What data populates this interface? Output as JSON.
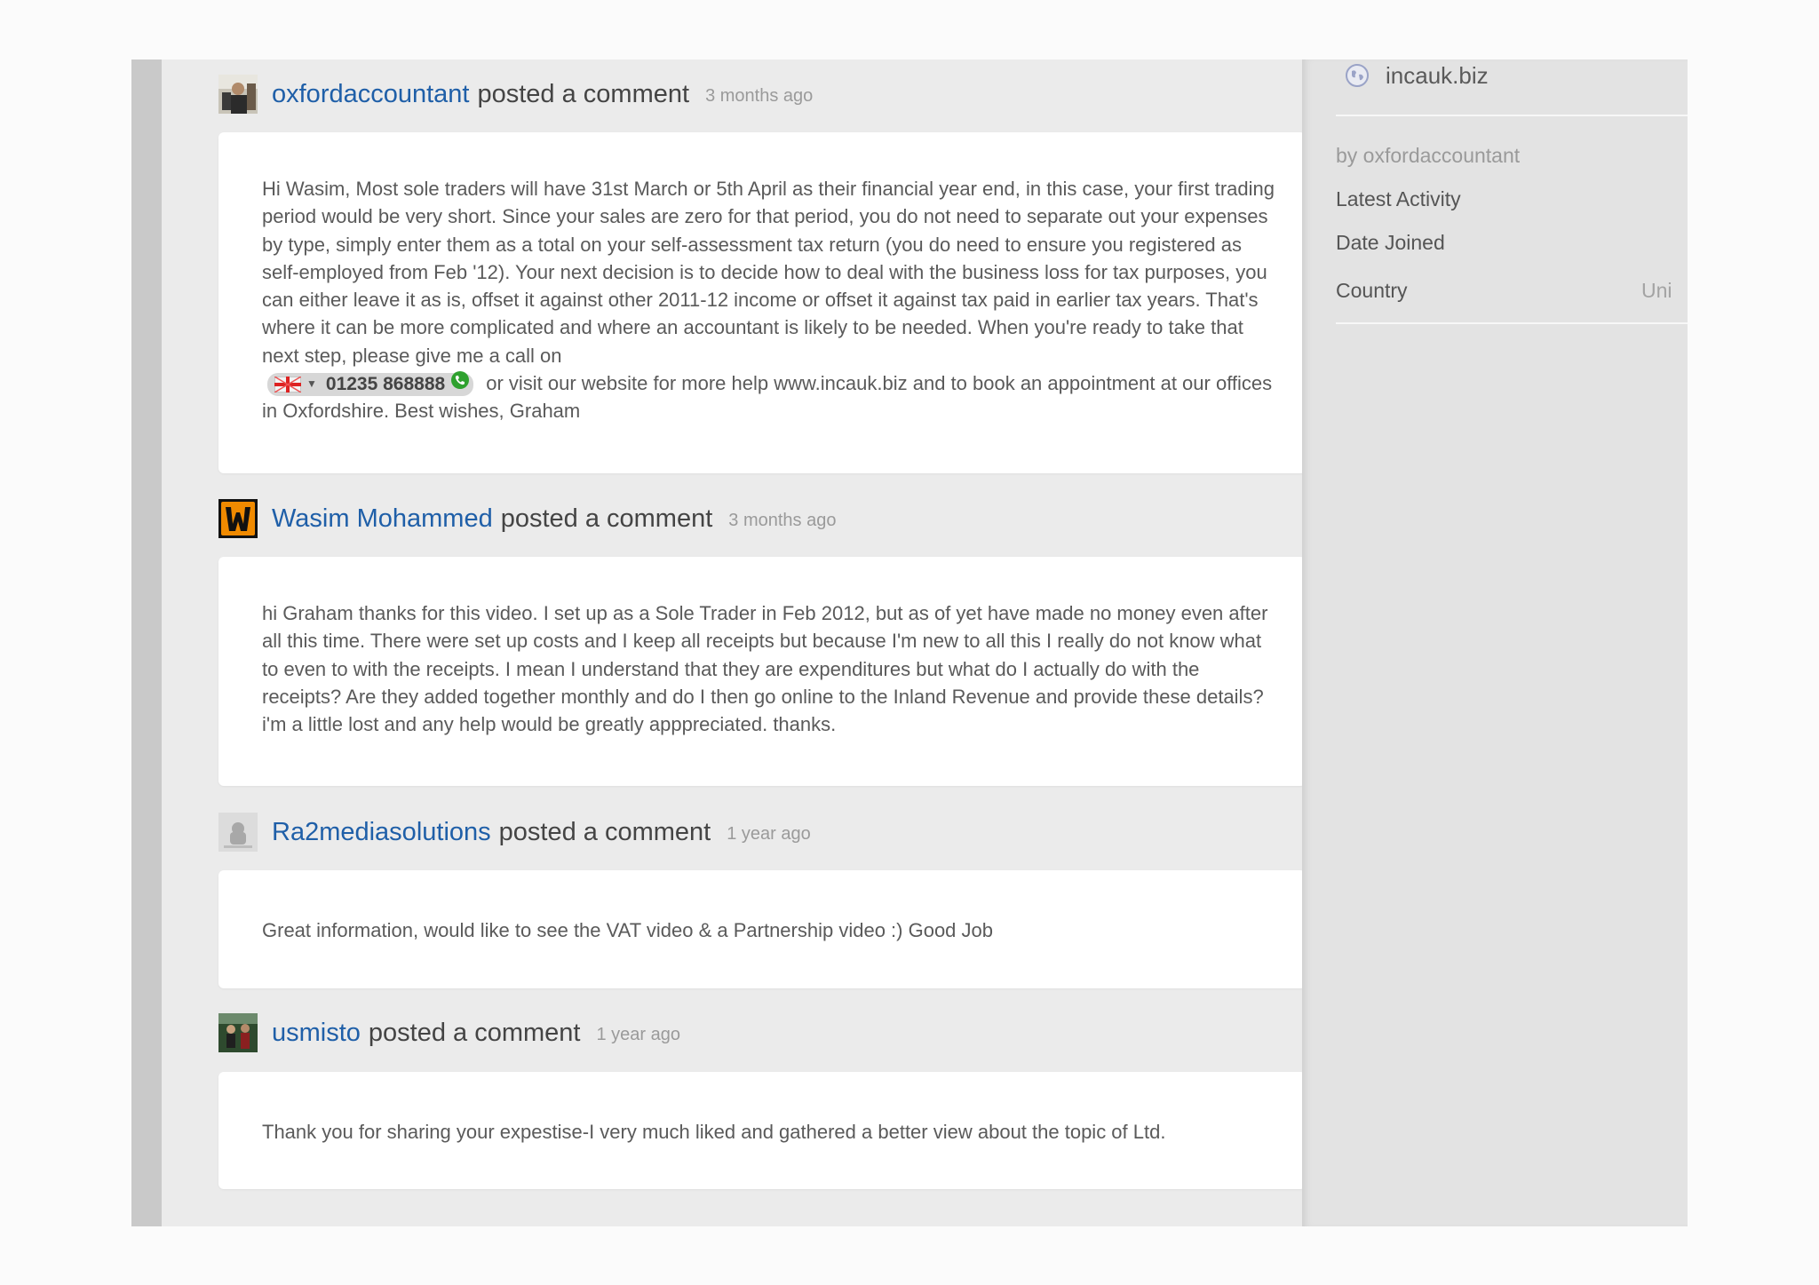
{
  "comments": [
    {
      "author": "oxfordaccountant",
      "action": "posted a comment",
      "time": "3 months ago",
      "text_before_phone": "Hi Wasim, Most sole traders will have 31st March or 5th April as their financial year end, in this case, your first trading period would be very short. Since your sales are zero for that period, you do not need to separate out your expenses by type, simply enter them as a total on your self-assessment tax return (you do need to ensure you registered as self-employed from Feb '12). Your next decision is to decide how to deal with the business loss for tax purposes, you can either leave it as is, offset it against other 2011-12 income or offset it against tax paid in earlier tax years. That's where it can be more complicated and where an accountant is likely to be needed. When you're ready to take that next step, please give me a call on",
      "phone": "01235 868888",
      "text_after_phone": "or visit our website for more help www.incauk.biz and to book an appointment at our offices in Oxfordshire. Best wishes, Graham"
    },
    {
      "author": "Wasim Mohammed",
      "action": "posted a comment",
      "time": "3 months ago",
      "text": "hi Graham thanks for this video. I set up as a Sole Trader in Feb 2012, but as of yet have made no money even after all this time. There were set up costs and I keep all receipts but because I'm new to all this I really do not know what to even to with the receipts. I mean I understand that they are expenditures but what do I actually do with the receipts? Are they added together monthly and do I then go online to the Inland Revenue and provide these details? i'm a little lost and any help would be greatly apppreciated. thanks."
    },
    {
      "author": "Ra2mediasolutions",
      "action": "posted a comment",
      "time": "1 year ago",
      "text": "Great information, would like to see the VAT video & a Partnership video :) Good Job"
    },
    {
      "author": "usmisto",
      "action": "posted a comment",
      "time": "1 year ago",
      "text": "Thank you for sharing your expestise-I very much liked and gathered a better view about the topic of Ltd."
    }
  ],
  "sidebar": {
    "website": "incauk.biz",
    "by": "by oxfordaccountant",
    "latest_activity_label": "Latest Activity",
    "date_joined_label": "Date Joined",
    "country_label": "Country",
    "country_value": "Uni"
  },
  "colors": {
    "link": "#1f5fa8",
    "text": "#5a5a5a",
    "muted": "#9a9a9a",
    "card": "#ffffff",
    "background": "#ebebeb"
  }
}
